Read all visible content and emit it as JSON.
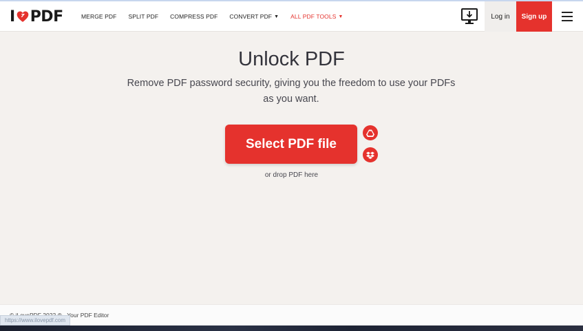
{
  "brand": {
    "logo_prefix": "I",
    "logo_suffix": "PDF",
    "accent": "#e5322d"
  },
  "nav": {
    "items": [
      {
        "label": "MERGE PDF"
      },
      {
        "label": "SPLIT PDF"
      },
      {
        "label": "COMPRESS PDF"
      },
      {
        "label": "CONVERT PDF"
      },
      {
        "label": "ALL PDF TOOLS"
      }
    ]
  },
  "header": {
    "login_label": "Log in",
    "signup_label": "Sign up"
  },
  "main": {
    "title": "Unlock PDF",
    "subtitle": "Remove PDF password security, giving you the freedom to use your PDFs as you want.",
    "select_label": "Select PDF file",
    "drop_hint": "or drop PDF here"
  },
  "footer": {
    "copyright": "© iLovePDF 2022 ® - Your PDF Editor"
  },
  "status_bar": {
    "url": "https://www.ilovepdf.com"
  }
}
